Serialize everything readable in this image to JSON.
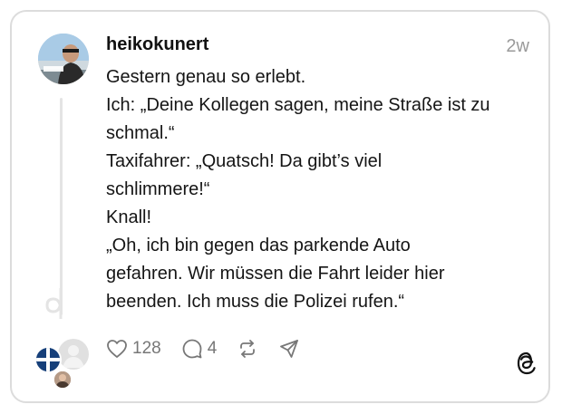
{
  "post": {
    "username": "heikokunert",
    "time": "2w",
    "lines": [
      "Gestern genau so erlebt.",
      "Ich: „Deine Kollegen sagen, meine Straße ist zu",
      "schmal.“",
      "Taxifahrer: „Quatsch! Da gibt’s viel",
      "schlimmere!“",
      "Knall!",
      "„Oh, ich bin gegen das parkende Auto",
      "gefahren. Wir müssen die Fahrt leider hier",
      "beenden. Ich muss die Polizei rufen.“"
    ]
  },
  "actions": {
    "like_count": "128",
    "reply_count": "4"
  },
  "icons": {
    "like": "heart-icon",
    "reply": "comment-icon",
    "repost": "repost-icon",
    "share": "send-icon",
    "brand": "threads-logo-icon"
  },
  "colors": {
    "text": "#151515",
    "muted": "#777777",
    "border": "#dcdcdc"
  }
}
